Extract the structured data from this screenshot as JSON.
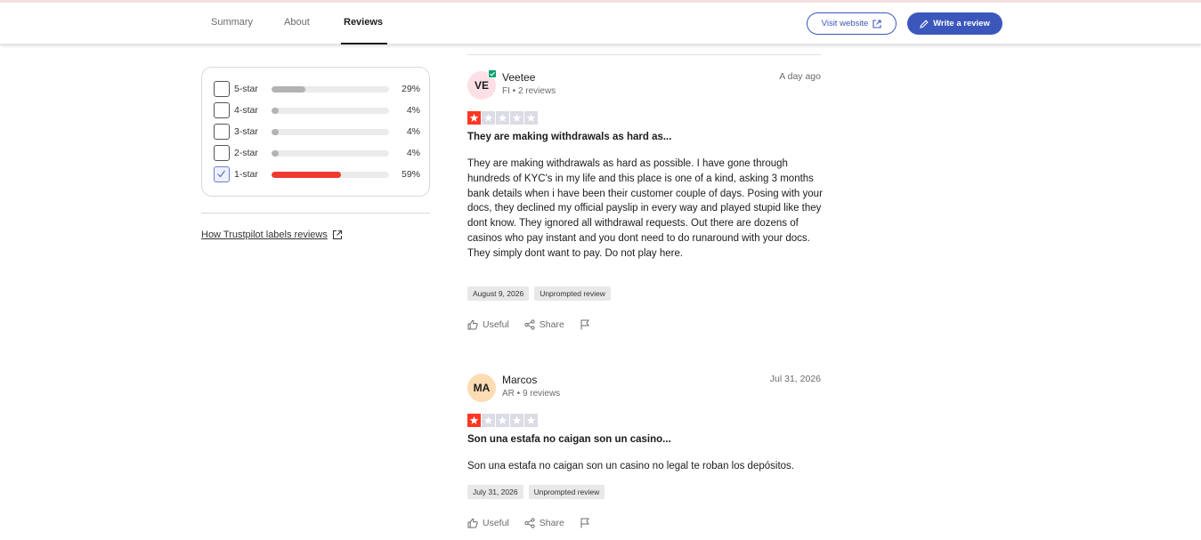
{
  "nav": {
    "tabs": [
      {
        "label": "Summary"
      },
      {
        "label": "About"
      },
      {
        "label": "Reviews"
      }
    ],
    "visit_label": "Visit website",
    "write_label": "Write a review"
  },
  "filters": {
    "rows": [
      {
        "label": "5-star",
        "percent": "29%",
        "fill": 0.29,
        "checked": false
      },
      {
        "label": "4-star",
        "percent": "4%",
        "fill": 0.04,
        "checked": false
      },
      {
        "label": "3-star",
        "percent": "4%",
        "fill": 0.04,
        "checked": false
      },
      {
        "label": "2-star",
        "percent": "4%",
        "fill": 0.04,
        "checked": false
      },
      {
        "label": "1-star",
        "percent": "59%",
        "fill": 0.59,
        "checked": true
      }
    ],
    "how_link": "How Trustpilot labels reviews"
  },
  "reviews": [
    {
      "initials": "VE",
      "avatar_color": "#fde0e6",
      "verified": true,
      "name": "Veetee",
      "meta": "FI • 2 reviews",
      "date": "A day ago",
      "rating": 1,
      "title": "They are making withdrawals as hard as...",
      "body": "They are making withdrawals as hard as possible. I have gone through hundreds of KYC's in my life and this place is one of a kind, asking 3 months bank details when i have been their customer couple of days. Posing with your docs, they declined my official payslip in every way and played stupid like they dont know. They ignored all withdrawal requests. Out there are dozens of casinos who pay instant and you dont need to do runaround with your docs. They simply dont want to pay. Do not play here.",
      "experience_date": "August 9, 2026",
      "tag": "Unprompted review",
      "useful": "Useful",
      "share": "Share"
    },
    {
      "initials": "MA",
      "avatar_color": "#fddcb3",
      "verified": false,
      "name": "Marcos",
      "meta": "AR • 9 reviews",
      "date": "Jul 31, 2026",
      "rating": 1,
      "title": "Son una estafa no caigan son un casino...",
      "body": "Son una estafa no caigan son un casino no legal te roban los depósitos.",
      "experience_date": "July 31, 2026",
      "tag": "Unprompted review",
      "useful": "Useful",
      "share": "Share"
    }
  ],
  "colors": {
    "accent": "#3c57bc",
    "star_red": "#ff3722",
    "bar_red": "#ee3a2f",
    "verified_green": "#04a16c"
  }
}
